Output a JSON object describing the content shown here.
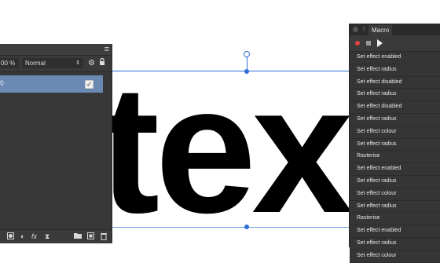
{
  "canvas": {
    "text": "tex"
  },
  "layers_panel": {
    "menu_icon": "hamburger-menu-icon",
    "opacity_value": "00 %",
    "blend_mode": "Normal",
    "layer_label": "t)",
    "layer_visible_checked": true,
    "footer_icons": [
      "mask-icon",
      "adjustment-icon",
      "fx-icon",
      "hourglass-icon",
      "folder-icon",
      "group-icon",
      "trash-icon"
    ]
  },
  "macro_panel": {
    "title": "Macro",
    "actions": [
      "Set effect enabled",
      "Set effect radius",
      "Set effect disabled",
      "Set effect radius",
      "Set effect disabled",
      "Set effect radius",
      "Set effect colour",
      "Set effect radius",
      "Rasterise",
      "Set effect enabled",
      "Set effect radius",
      "Set effect colour",
      "Set effect radius",
      "Rasterise",
      "Set effect enabled",
      "Set effect radius",
      "Set effect colour"
    ]
  },
  "colors": {
    "selection": "#2e6fd8",
    "panel_bg": "#383838",
    "layer_highlight": "#6a8ab4",
    "record": "#e24444"
  }
}
